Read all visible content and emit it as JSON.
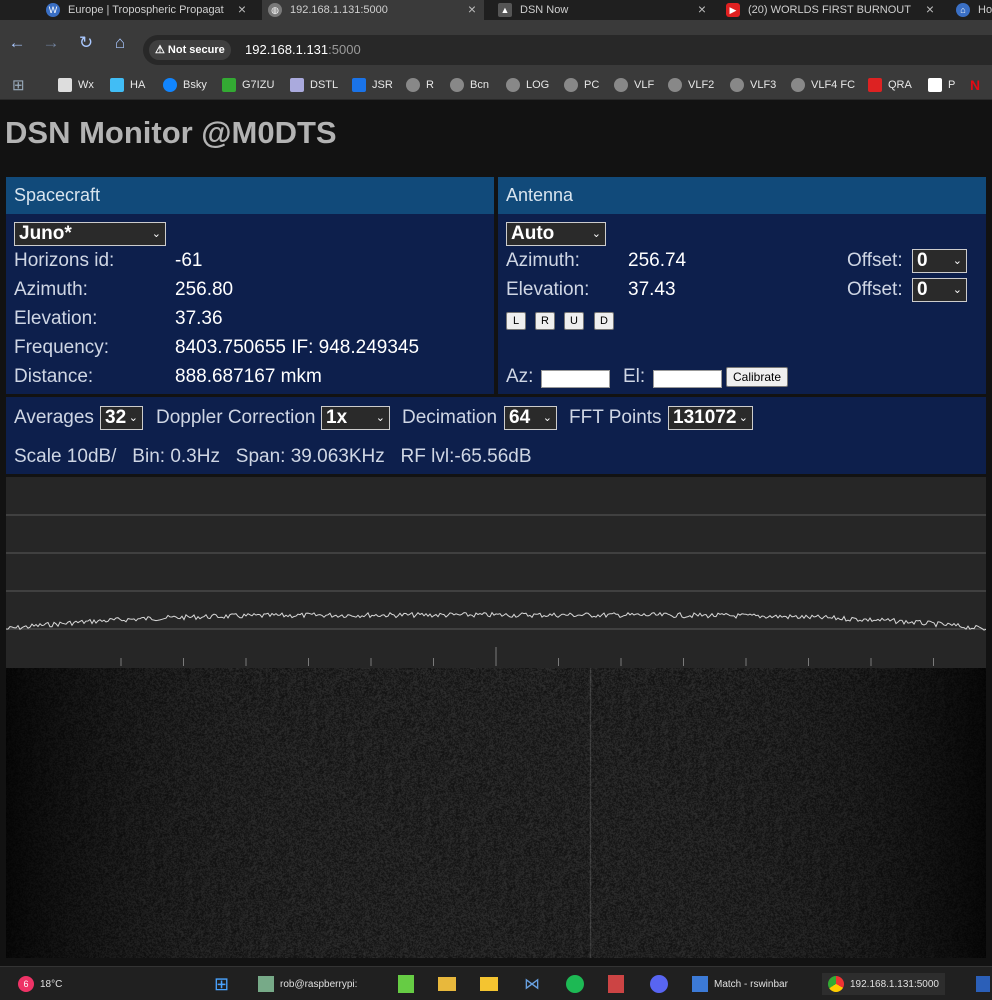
{
  "browser": {
    "tabs": [
      {
        "title": "Europe | Tropospheric Propagat",
        "active": false
      },
      {
        "title": "192.168.1.131:5000",
        "active": true
      },
      {
        "title": "DSN Now",
        "active": false
      },
      {
        "title": "(20) WORLDS FIRST BURNOUT",
        "active": false
      },
      {
        "title": "Ho",
        "active": false
      }
    ],
    "security_label": "Not secure",
    "url_host": "192.168.1.131",
    "url_port": ":5000",
    "bookmarks": [
      "Wx",
      "HA",
      "Bsky",
      "G7IZU",
      "DSTL",
      "JSR",
      "R",
      "Bcn",
      "LOG",
      "PC",
      "VLF",
      "VLF2",
      "VLF3",
      "VLF4 FC",
      "QRA",
      "P"
    ]
  },
  "page": {
    "title": "DSN Monitor @M0DTS",
    "spacecraft": {
      "header": "Spacecraft",
      "selected": "Juno*",
      "rows": [
        {
          "label": "Horizons id:",
          "value": "-61"
        },
        {
          "label": "Azimuth:",
          "value": "256.80"
        },
        {
          "label": "Elevation:",
          "value": "37.36"
        },
        {
          "label": "Frequency:",
          "value": "8403.750655 IF: 948.249345"
        },
        {
          "label": "Distance:",
          "value": "888.687167 mkm"
        }
      ]
    },
    "antenna": {
      "header": "Antenna",
      "mode": "Auto",
      "azimuth_label": "Azimuth:",
      "azimuth_value": "256.74",
      "elevation_label": "Elevation:",
      "elevation_value": "37.43",
      "offset_label": "Offset:",
      "offset_az": "0",
      "offset_el": "0",
      "buttons": [
        "L",
        "R",
        "U",
        "D"
      ],
      "az_input_label": "Az:",
      "el_input_label": "El:",
      "calibrate_label": "Calibrate"
    },
    "controls": {
      "averages_label": "Averages",
      "averages_value": "32",
      "doppler_label": "Doppler Correction",
      "doppler_value": "1x",
      "decimation_label": "Decimation",
      "decimation_value": "64",
      "fft_label": "FFT Points",
      "fft_value": "131072",
      "status": "Scale 10dB/   Bin: 0.3Hz   Span: 39.063KHz   RF lvl:-65.56dB"
    }
  },
  "taskbar": {
    "weather_badge": "6",
    "weather_temp": "18°C",
    "items": [
      "rob@raspberrypi:",
      "Match - rswinbar",
      "192.168.1.131:5000"
    ]
  },
  "colors": {
    "panel_bg": "#0d1f4c",
    "panel_header": "#114a7a",
    "page_bg": "#121212"
  }
}
